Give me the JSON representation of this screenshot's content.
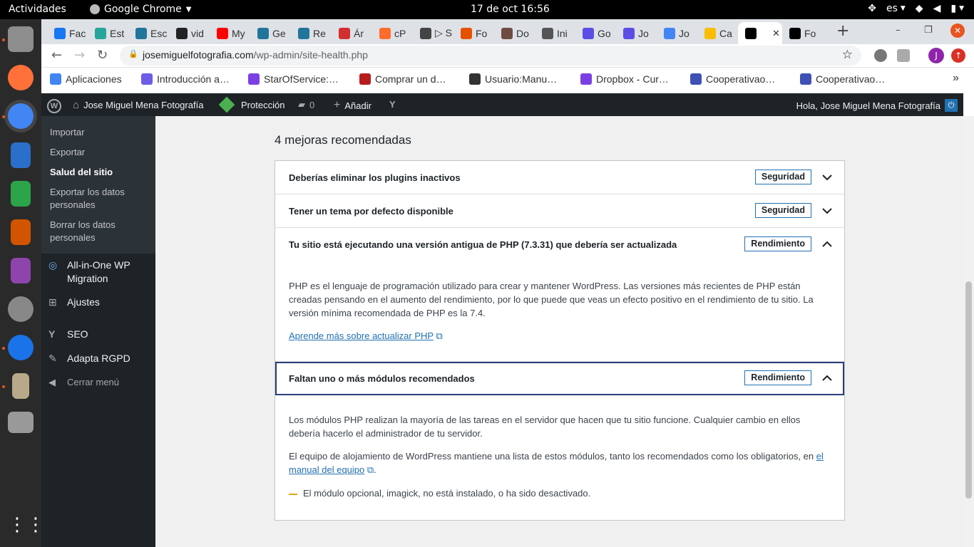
{
  "system": {
    "activities": "Actividades",
    "app_name": "Google Chrome",
    "clock": "17 de oct  16:56",
    "lang": "es"
  },
  "tabs": [
    {
      "label": "Fac",
      "color": "#1877f2"
    },
    {
      "label": "Est",
      "color": "#26a69a"
    },
    {
      "label": "Esc",
      "color": "#21759b"
    },
    {
      "label": "vid",
      "color": "#222222"
    },
    {
      "label": "My",
      "color": "#ff0000"
    },
    {
      "label": "Ge",
      "color": "#21759b"
    },
    {
      "label": "Re",
      "color": "#21759b"
    },
    {
      "label": "Ár",
      "color": "#d32f2f"
    },
    {
      "label": "cP",
      "color": "#ff6c2c"
    },
    {
      "label": "▷ S",
      "color": "#444444"
    },
    {
      "label": "Fo",
      "color": "#e65100"
    },
    {
      "label": "Do",
      "color": "#6d4c41"
    },
    {
      "label": "Ini",
      "color": "#555555"
    },
    {
      "label": "Go",
      "color": "#5c4ee5"
    },
    {
      "label": "Jo",
      "color": "#5c4ee5"
    },
    {
      "label": "Jo",
      "color": "#4285f4"
    },
    {
      "label": "Ca",
      "color": "#fbbc04"
    },
    {
      "label": "",
      "color": "#000000"
    },
    {
      "label": "Fo",
      "color": "#000000"
    }
  ],
  "address": {
    "domain": "josemiguelfotografia.com",
    "path": "/wp-admin/site-health.php",
    "avatar_letter": "J"
  },
  "bookmarks": [
    {
      "label": "Aplicaciones",
      "color": "#4285f4"
    },
    {
      "label": "Introducción a…",
      "color": "#6c5ce7"
    },
    {
      "label": "StarOfService:…",
      "color": "#7b3fe4"
    },
    {
      "label": "Comprar un d…",
      "color": "#b71c1c"
    },
    {
      "label": "Usuario:Manu…",
      "color": "#333333"
    },
    {
      "label": "Dropbox - Cur…",
      "color": "#7b3fe4"
    },
    {
      "label": "Cooperativao…",
      "color": "#3f51b5"
    },
    {
      "label": "Cooperativao…",
      "color": "#3f51b5"
    }
  ],
  "adminbar": {
    "site": "Jose Miguel Mena Fotografía",
    "protection": "Protección",
    "comments": "0",
    "add": "Añadir",
    "greeting": "Hola, Jose Miguel Mena Fotografía"
  },
  "sidebar": {
    "submenu": [
      "Importar",
      "Exportar",
      "Salud del sitio",
      "Exportar los datos personales",
      "Borrar los datos personales"
    ],
    "items": [
      "All-in-One WP Migration",
      "Ajustes",
      "SEO",
      "Adapta RGPD",
      "Cerrar menú"
    ]
  },
  "main": {
    "heading": "4 mejoras recomendadas",
    "issues": [
      {
        "title": "Deberías eliminar los plugins inactivos",
        "badge": "Seguridad"
      },
      {
        "title": "Tener un tema por defecto disponible",
        "badge": "Seguridad"
      },
      {
        "title": "Tu sitio está ejecutando una versión antigua de PHP (7.3.31) que debería ser actualizada",
        "badge": "Rendimiento",
        "body": "PHP es el lenguaje de programación utilizado para crear y mantener WordPress. Las versiones más recientes de PHP están creadas pensando en el aumento del rendimiento, por lo que puede que veas un efecto positivo en el rendimiento de tu sitio. La versión mínima recomendada de PHP es la 7.4.",
        "link": "Aprende más sobre actualizar PHP"
      },
      {
        "title": "Faltan uno o más módulos recomendados",
        "badge": "Rendimiento",
        "body1": "Los módulos PHP realizan la mayoría de las tareas en el servidor que hacen que tu sitio funcione. Cualquier cambio en ellos debería hacerlo el administrador de tu servidor.",
        "body2": "El equipo de alojamiento de WordPress mantiene una lista de estos módulos, tanto los recomendados como los obligatorios, en",
        "link": "el manual del equipo",
        "after_link": ".",
        "note": "El módulo opcional, imagick, no está instalado, o ha sido desactivado."
      }
    ]
  }
}
